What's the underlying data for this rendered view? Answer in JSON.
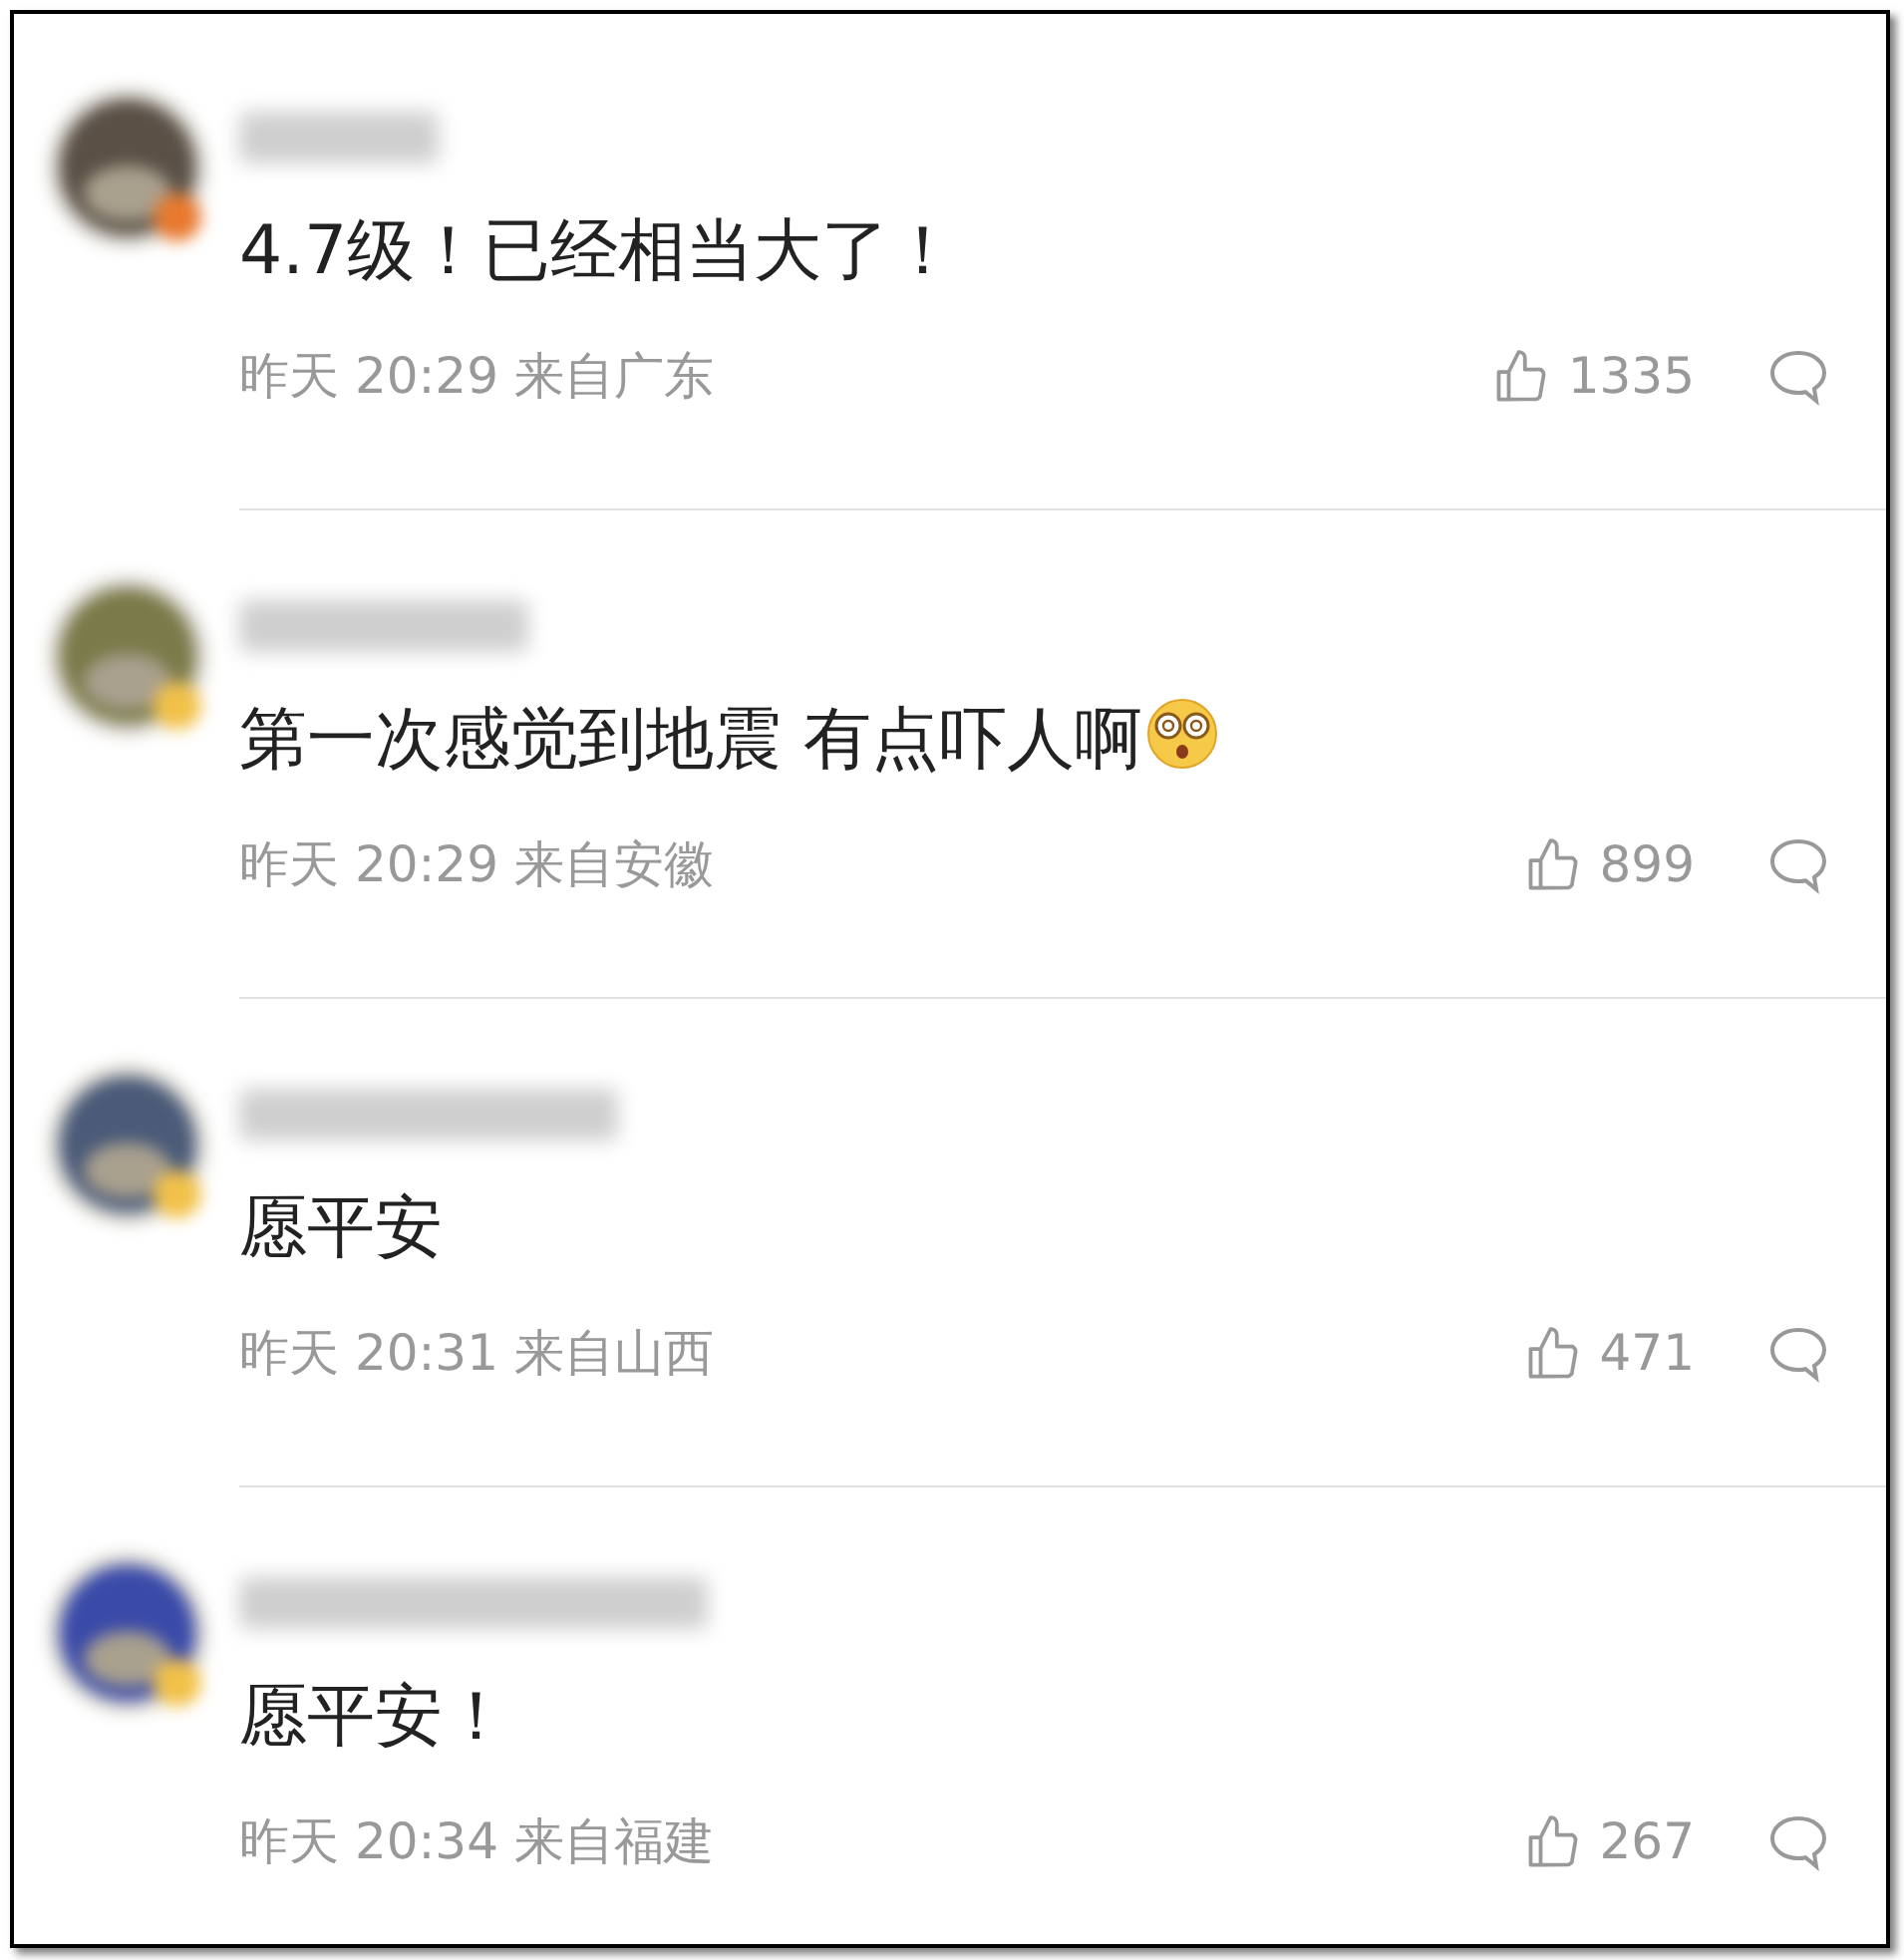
{
  "comments": [
    {
      "text": "4.7级！已经相当大了！",
      "emoji": false,
      "time": "昨天 20:29 来自广东",
      "likes": "1335"
    },
    {
      "text": "第一次感觉到地震 有点吓人啊",
      "emoji": true,
      "time": "昨天 20:29 来自安徽",
      "likes": "899"
    },
    {
      "text": "愿平安",
      "emoji": false,
      "time": "昨天 20:31 来自山西",
      "likes": "471"
    },
    {
      "text": "愿平安！",
      "emoji": false,
      "time": "昨天 20:34 来自福建",
      "likes": "267"
    }
  ]
}
